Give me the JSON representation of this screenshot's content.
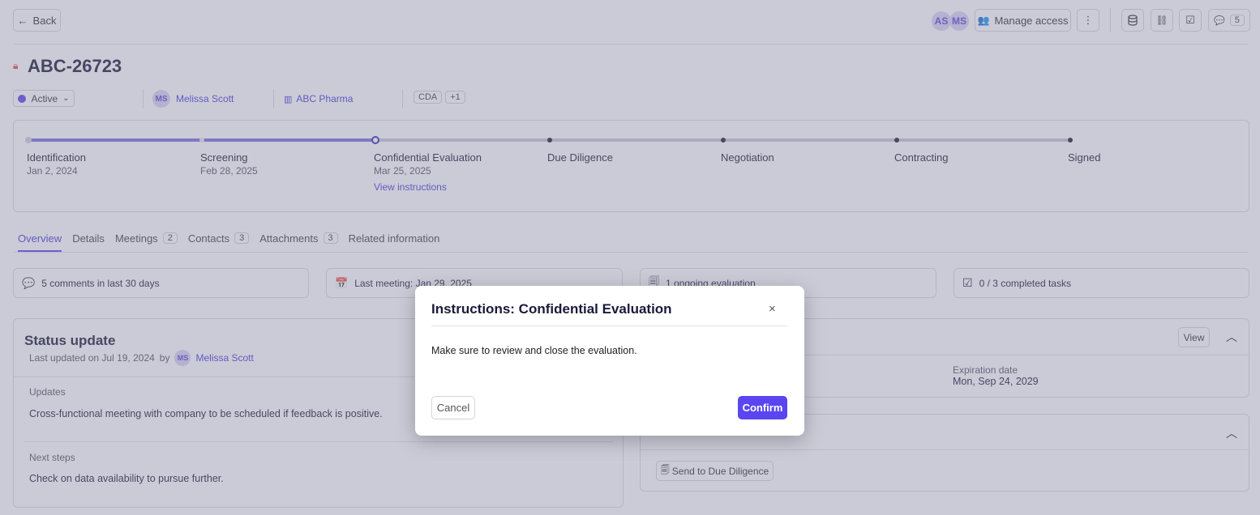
{
  "header": {
    "back_label": "Back",
    "avatars": [
      "AS",
      "MS"
    ],
    "manage_access_label": "Manage access",
    "comments_count": "5"
  },
  "record": {
    "title": "ABC-26723",
    "status": "Active",
    "owner_initials": "MS",
    "owner_name": "Melissa Scott",
    "company": "ABC Pharma",
    "tag": "CDA",
    "tag_more": "+1"
  },
  "stages": [
    {
      "name": "Identification",
      "date": "Jan 2, 2024"
    },
    {
      "name": "Screening",
      "date": "Feb 28, 2025"
    },
    {
      "name": "Confidential Evaluation",
      "date": "Mar 25, 2025",
      "link": "View instructions"
    },
    {
      "name": "Due Diligence",
      "date": ""
    },
    {
      "name": "Negotiation",
      "date": ""
    },
    {
      "name": "Contracting",
      "date": ""
    },
    {
      "name": "Signed",
      "date": ""
    }
  ],
  "tabs": [
    {
      "label": "Overview",
      "count": ""
    },
    {
      "label": "Details",
      "count": ""
    },
    {
      "label": "Meetings",
      "count": "2"
    },
    {
      "label": "Contacts",
      "count": "3"
    },
    {
      "label": "Attachments",
      "count": "3"
    },
    {
      "label": "Related information",
      "count": ""
    }
  ],
  "summary": {
    "comments": "5 comments in last 30 days",
    "last_meeting": "Last meeting: Jan 29, 2025",
    "evaluations": "1 ongoing evaluation",
    "tasks": "0 / 3 completed tasks"
  },
  "status_update": {
    "title": "Status update",
    "last_updated": "Last updated on Jul 19, 2024",
    "by": "by",
    "author_initials": "MS",
    "author_name": "Melissa Scott",
    "updates_label": "Updates",
    "updates_text": "Cross-functional meeting with company to be scheduled if feedback is positive.",
    "next_steps_label": "Next steps",
    "next_steps_text": "Check on data availability to pursue further."
  },
  "right_panel": {
    "view_label": "View",
    "expiration_label": "Expiration date",
    "expiration_value": "Mon, Sep 24, 2029",
    "send_label": "Send to Due Diligence"
  },
  "modal": {
    "title": "Instructions: Confidential Evaluation",
    "body": "Make sure to review and close the evaluation.",
    "cancel_label": "Cancel",
    "confirm_label": "Confirm"
  },
  "colors": {
    "accent": "#5b45f0",
    "progress": "#7c6ee0",
    "track": "#c9c9d6"
  }
}
